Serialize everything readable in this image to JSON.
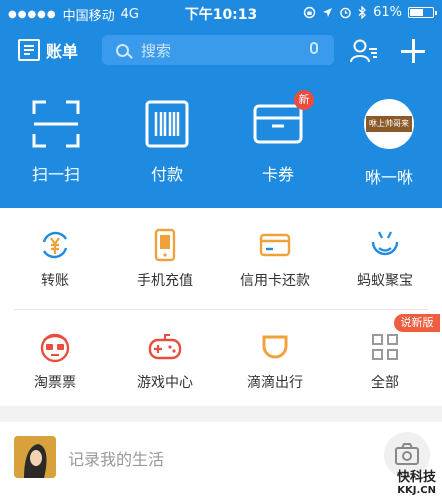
{
  "status": {
    "carrier": "中国移动",
    "network": "4G",
    "time": "下午10:13",
    "battery": "61%",
    "battery_fraction": 0.61
  },
  "topbar": {
    "bill_label": "账单",
    "search_placeholder": "搜索"
  },
  "quick_actions": [
    {
      "label": "扫一扫",
      "icon": "scan-icon"
    },
    {
      "label": "付款",
      "icon": "barcode-icon"
    },
    {
      "label": "卡券",
      "icon": "wallet-icon",
      "badge": "新"
    },
    {
      "label": "咻一咻",
      "icon": "xiu-avatar-icon",
      "avatar_text": "咻上帅哥来"
    }
  ],
  "services": [
    {
      "label": "转账",
      "icon": "yen-transfer-icon"
    },
    {
      "label": "手机充值",
      "icon": "phone-icon"
    },
    {
      "label": "信用卡还款",
      "icon": "credit-card-icon"
    },
    {
      "label": "蚂蚁聚宝",
      "icon": "ant-face-icon"
    },
    {
      "label": "淘票票",
      "icon": "glasses-face-icon"
    },
    {
      "label": "游戏中心",
      "icon": "gamepad-icon"
    },
    {
      "label": "滴滴出行",
      "icon": "didi-icon"
    },
    {
      "label": "全部",
      "icon": "grid-icon",
      "badge": "说新版"
    }
  ],
  "life": {
    "prompt": "记录我的生活"
  },
  "watermark": {
    "line1": "快科技",
    "line2": "KKJ.CN"
  },
  "colors": {
    "primary": "#1f8be0",
    "orange": "#f0a23a",
    "red": "#e94d3d",
    "text": "#333333"
  }
}
